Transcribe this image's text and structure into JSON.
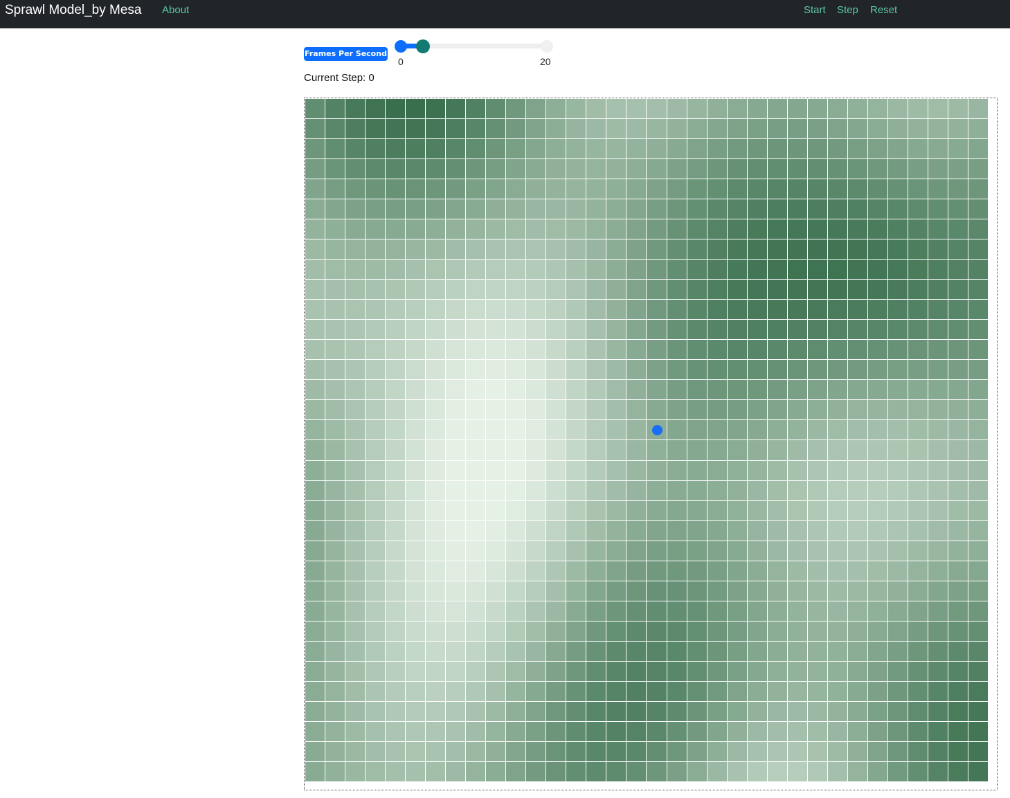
{
  "navbar": {
    "title": "Sprawl Model_by Mesa",
    "about": "About",
    "start": "Start",
    "step": "Step",
    "reset": "Reset"
  },
  "controls": {
    "fps_label": "Frames Per Second",
    "fps_min": "0",
    "fps_max": "20",
    "fps_value": 3,
    "current_step_label": "Current Step: 0"
  },
  "grid": {
    "columns": 34,
    "rows": 34,
    "colors": {
      "low": "#f2faf0",
      "high": "#00441b",
      "agent": "#1a6ef5"
    },
    "agent_cell": {
      "col": 17,
      "row": 16
    }
  }
}
